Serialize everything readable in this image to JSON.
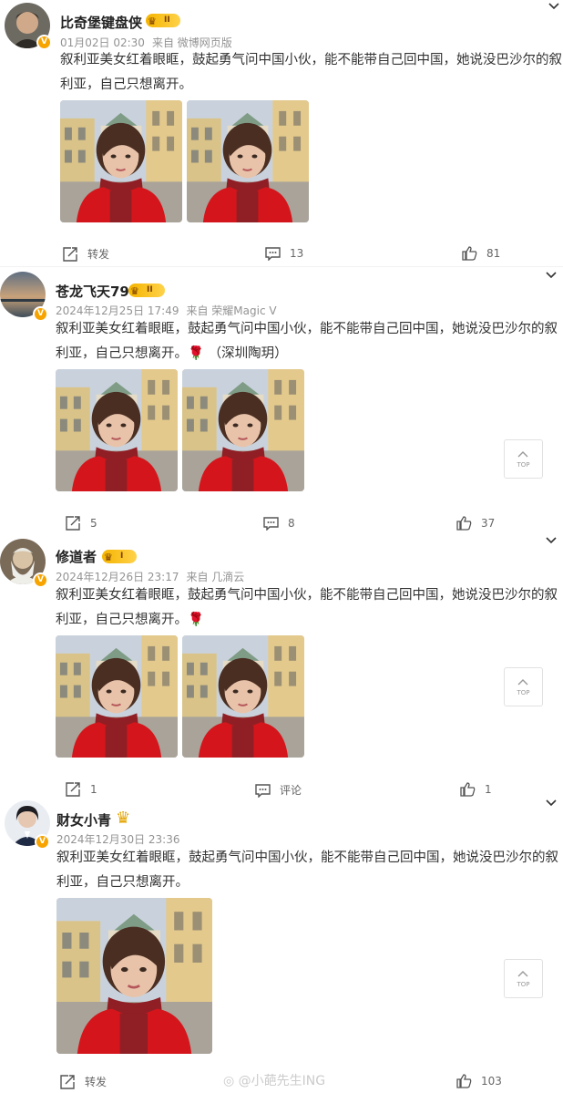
{
  "posts": [
    {
      "username": "比奇堡键盘侠",
      "level": "II",
      "date": "01月02日 02:30",
      "source": "来自 微博网页版",
      "line1": "叙利亚美女红着眼眶，鼓起勇气问中国小伙，能不能带自己回中国，她说没巴沙尔的叙",
      "line2": "利亚，自己只想离开。",
      "repost": "转发",
      "comments": "13",
      "likes": "81"
    },
    {
      "username": "苍龙飞天79",
      "level": "II",
      "date": "2024年12月25日 17:49",
      "source": "来自 荣耀Magic V",
      "line1": "叙利亚美女红着眼眶，鼓起勇气问中国小伙，能不能带自己回中国，她说没巴沙尔的叙",
      "line2": "利亚，自己只想离开。🌹 （深圳陶玥）",
      "repost": "5",
      "comments": "8",
      "likes": "37"
    },
    {
      "username": "修道者",
      "level": "I",
      "date": "2024年12月26日 23:17",
      "source": "来自 几滴云",
      "line1": "叙利亚美女红着眼眶，鼓起勇气问中国小伙，能不能带自己回中国，她说没巴沙尔的叙",
      "line2": "利亚，自己只想离开。🌹",
      "repost": "1",
      "comments": "评论",
      "likes": "1"
    },
    {
      "username": "财女小青",
      "date": "2024年12月30日 23:36",
      "line1": "叙利亚美女红着眼眶，鼓起勇气问中国小伙，能不能带自己回中国，她说没巴沙尔的叙",
      "line2": "利亚，自己只想离开。",
      "repost": "转发",
      "likes": "103"
    }
  ],
  "top_button": "TOP",
  "watermark": "@小葩先生ING",
  "verified_badge": "V",
  "icons": [
    "chevron-down-icon",
    "repost-icon",
    "comment-icon",
    "like-icon",
    "arrow-up-icon",
    "crown-icon",
    "weibo-logo-icon"
  ],
  "colors": {
    "text": "#333333",
    "meta": "#939393",
    "badge": "#f7a400",
    "level": "#f5b400",
    "coat": "#d4161c"
  }
}
